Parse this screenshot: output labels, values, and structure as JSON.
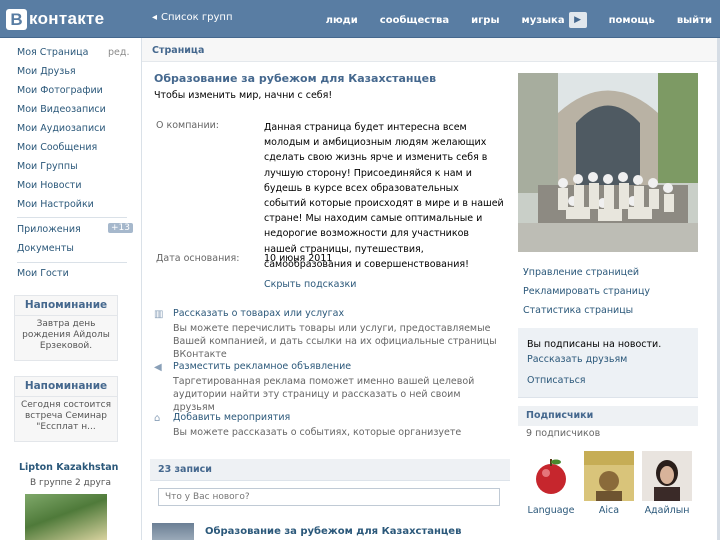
{
  "header": {
    "logo_letter": "В",
    "logo_text": "контакте",
    "back_arrow": "◂",
    "back_link": "Список групп",
    "nav": [
      "люди",
      "сообщества",
      "игры",
      "музыка"
    ],
    "play_icon": "▶",
    "nav_right": [
      "помощь",
      "выйти"
    ]
  },
  "sidebar": {
    "items": [
      {
        "label": "Моя Страница",
        "edit": "ред."
      },
      {
        "label": "Мои Друзья"
      },
      {
        "label": "Мои Фотографии"
      },
      {
        "label": "Мои Видеозаписи"
      },
      {
        "label": "Мои Аудиозаписи"
      },
      {
        "label": "Мои Сообщения"
      },
      {
        "label": "Мои Группы"
      },
      {
        "label": "Мои Новости"
      },
      {
        "label": "Мои Настройки"
      }
    ],
    "apps": {
      "label": "Приложения",
      "badge": "+13"
    },
    "docs": "Документы",
    "guests": "Мои Гости",
    "reminders": [
      {
        "title": "Напоминание",
        "text": "Завтра день рождения Айдолы Ерзековой."
      },
      {
        "title": "Напоминание",
        "text": "Сегодня состоится встреча Семинар \"Ессплат н..."
      }
    ],
    "ad": {
      "title": "Lipton Kazakhstan",
      "subtitle": "В группе 2 друга"
    }
  },
  "main": {
    "breadcrumb": "Страница",
    "title": "Образование за рубежом для Казахстанцев",
    "status": "Чтобы изменить мир, начни с себя!",
    "about_label": "О компании:",
    "about_text": "Данная страница будет интересна всем молодым и амбициозным людям желающих сделать свою жизнь ярче и изменить себя в лучшую сторону! Присоединяйся к нам и будешь в курсе всех образовательных событий которые происходят в мире и в нашей стране! Мы находим самые оптимальные и недорогие возможности для участников нашей страницы, путешествия, самообразования и совершенствования!",
    "founded_label": "Дата основания:",
    "founded_value": "10 июня 2011",
    "hide_tips": "Скрыть подсказки",
    "tips": [
      {
        "icon": "▥",
        "title": "Рассказать о товарах или услугах",
        "desc": "Вы можете перечислить товары или услуги, предоставляемые Вашей компанией, и дать ссылки на их официальные страницы ВКонтакте"
      },
      {
        "icon": "◀",
        "title": "Разместить рекламное объявление",
        "desc": "Таргетированная реклама поможет именно вашей целевой аудитории найти эту страницу и рассказать о ней своим друзьям"
      },
      {
        "icon": "⌂",
        "title": "Добавить мероприятия",
        "desc": "Вы можете рассказать о событиях, которые организуете"
      }
    ],
    "wall_title": "23 записи",
    "wall_placeholder": "Что у Вас нового?",
    "post_title": "Образование за рубежом для Казахстанцев"
  },
  "right": {
    "actions": [
      "Управление страницей",
      "Рекламировать страницу",
      "Статистика страницы"
    ],
    "subscribed_text": "Вы подписаны на новости.",
    "tell_friends": "Рассказать друзьям",
    "unsubscribe": "Отписаться",
    "subscribers_title": "Подписчики",
    "subscribers_count": "9 подписчиков",
    "subscribers": [
      {
        "name": "Language"
      },
      {
        "name": "Aica"
      },
      {
        "name": "Адайлын"
      }
    ]
  },
  "colors": {
    "header_blue": "#597da3",
    "link_blue": "#2b587a",
    "heading_blue": "#45688e",
    "page_bg": "#edeef0"
  }
}
